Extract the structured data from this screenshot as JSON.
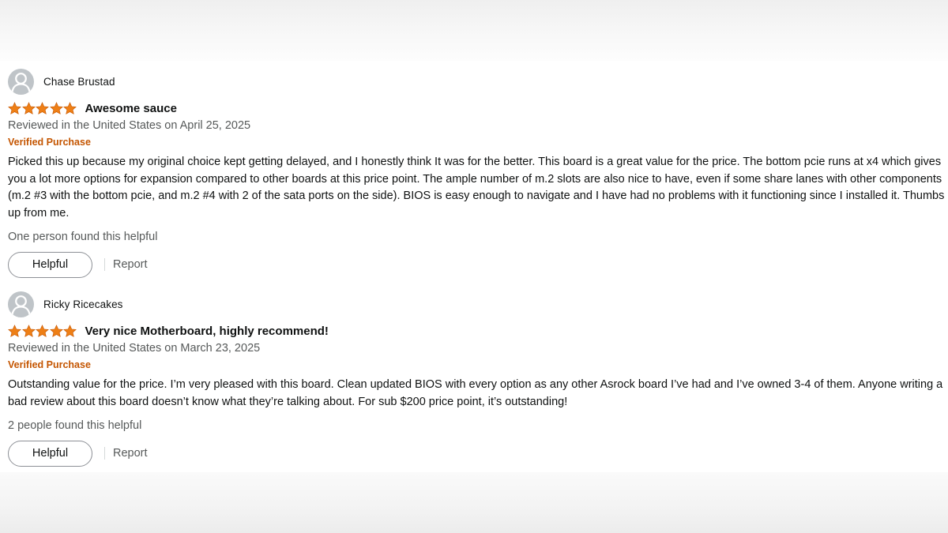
{
  "colors": {
    "star": "#ee7f16",
    "verified": "#c45500",
    "secondary_text": "#565959",
    "primary_text": "#0f1111"
  },
  "reviews": [
    {
      "reviewer": "Chase Brustad",
      "avatar_icon": "default-profile-icon",
      "rating": 5,
      "title": "Awesome sauce",
      "date": "Reviewed in the United States on April 25, 2025",
      "verified_label": "Verified Purchase",
      "body": "Picked this up because my original choice kept getting delayed, and I honestly think It was for the better. This board is a great value for the price. The bottom pcie runs at x4 which gives you a lot more options for expansion compared to other boards at this price point. The ample number of m.2 slots are also nice to have, even if some share lanes with other components (m.2 #3 with the bottom pcie, and m.2 #4 with 2 of the sata ports on the side). BIOS is easy enough to navigate and I have had no problems with it functioning since I installed it. Thumbs up from me.",
      "helpful_text": "One person found this helpful",
      "helpful_button": "Helpful",
      "report_label": "Report"
    },
    {
      "reviewer": "Ricky Ricecakes",
      "avatar_icon": "default-profile-icon",
      "rating": 5,
      "title": "Very nice Motherboard, highly recommend!",
      "date": "Reviewed in the United States on March 23, 2025",
      "verified_label": "Verified Purchase",
      "body": "Outstanding value for the price. I’m very pleased with this board. Clean updated BIOS with every option as any other Asrock board I’ve had and I’ve owned 3-4 of them. Anyone writing a bad review about this board doesn’t know what they’re talking about. For sub $200 price point, it’s outstanding!",
      "helpful_text": "2 people found this helpful",
      "helpful_button": "Helpful",
      "report_label": "Report"
    }
  ]
}
